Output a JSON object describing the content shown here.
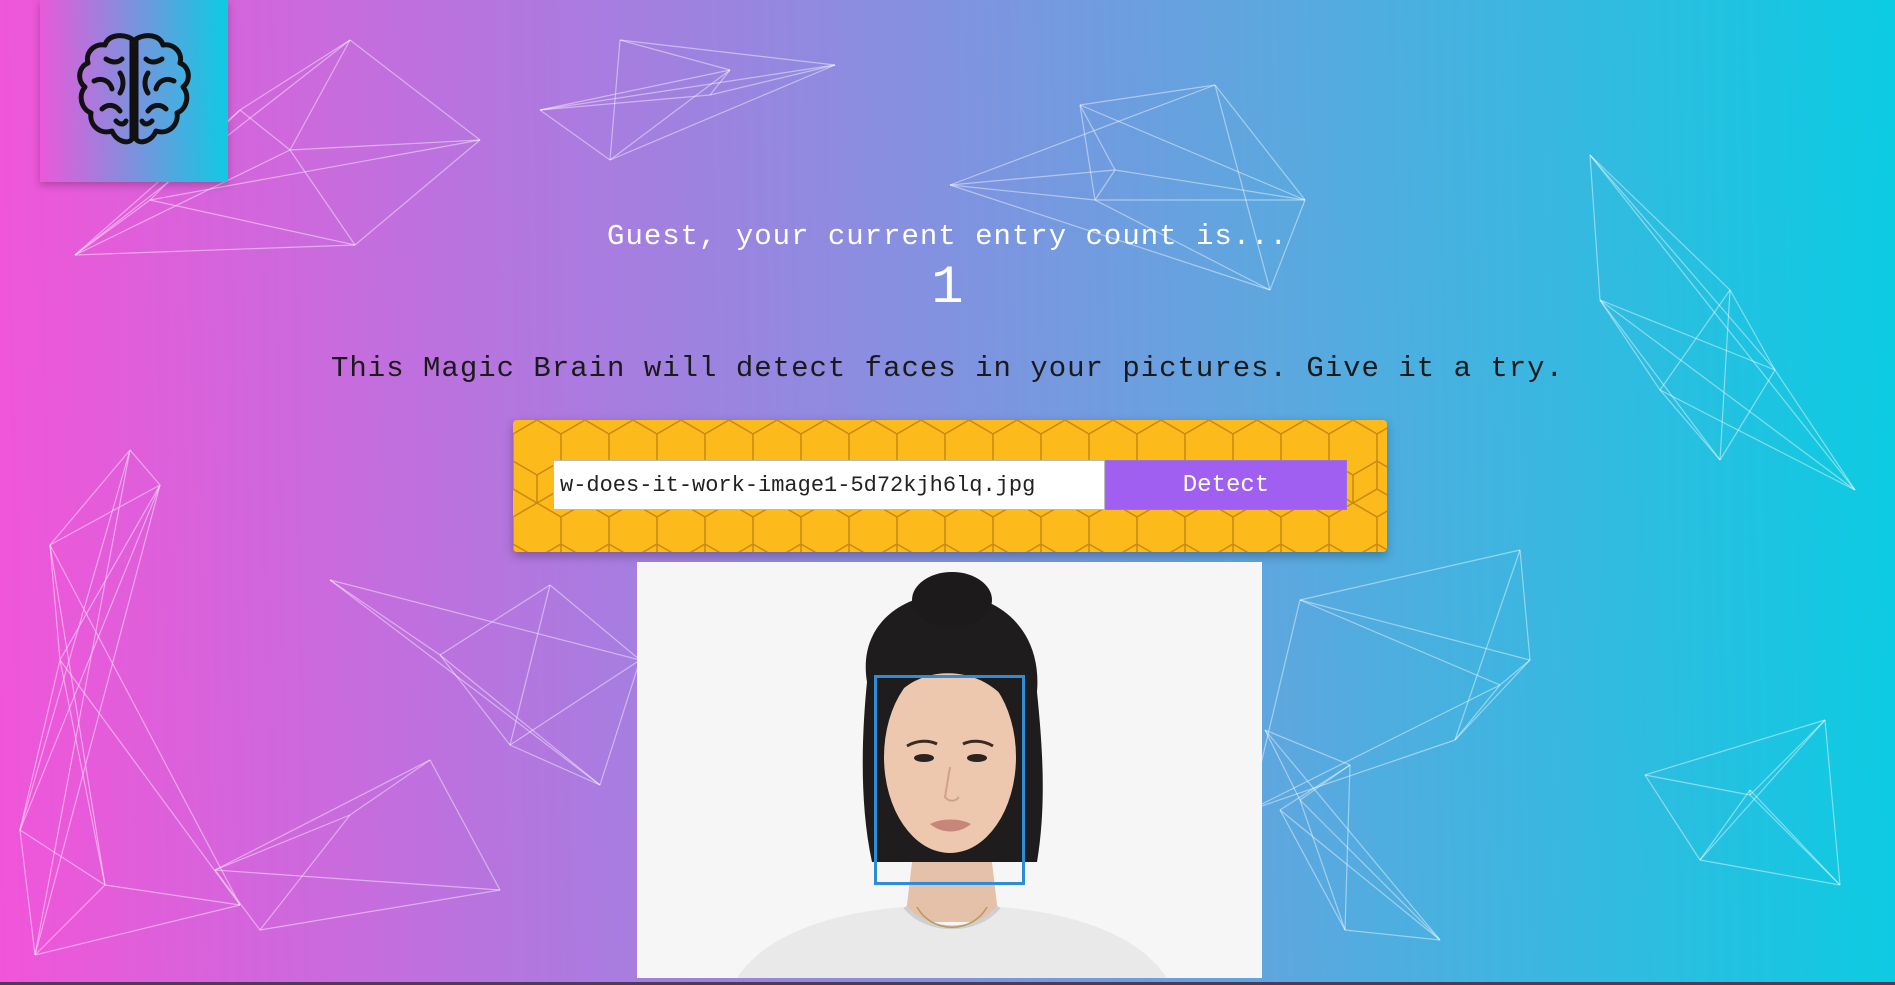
{
  "header": {
    "entry_text": "Guest, your current entry count is...",
    "entry_count": "1"
  },
  "main": {
    "tagline": "This Magic Brain will detect faces in your pictures. Give it a try.",
    "image_url_input": {
      "value": "w-does-it-work-image1-5d72kjh6lq.jpg",
      "placeholder": ""
    },
    "detect_label": "Detect"
  },
  "icons": {
    "logo": "brain-icon"
  },
  "colors": {
    "gradient_start": "#f155d9",
    "gradient_end": "#0bcce2",
    "form_panel": "#fcbb1a",
    "detect_button": "#a05ff0",
    "face_box": "#2f8dd8"
  }
}
